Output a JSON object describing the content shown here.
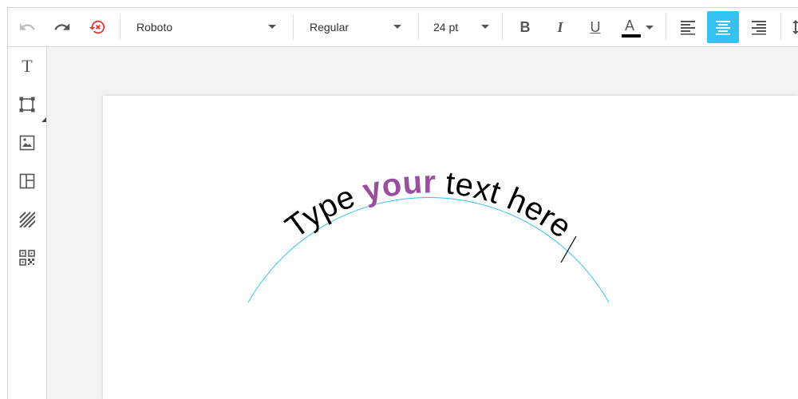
{
  "toolbar": {
    "font_family": "Roboto",
    "font_weight": "Regular",
    "font_size": "24 pt",
    "bold_label": "B",
    "italic_label": "I",
    "underline_label": "U",
    "font_color_label": "A",
    "font_color": "#000000",
    "accent_color": "#35c1f1",
    "active_alignment": "center"
  },
  "sidebar": {
    "items": [
      {
        "name": "text-tool",
        "icon": "text-icon"
      },
      {
        "name": "shape-tool",
        "icon": "shape-bounding-box-icon"
      },
      {
        "name": "image-tool",
        "icon": "image-icon"
      },
      {
        "name": "layout-tool",
        "icon": "layout-icon"
      },
      {
        "name": "pattern-tool",
        "icon": "diagonal-pattern-icon"
      },
      {
        "name": "qr-code-tool",
        "icon": "qr-code-icon"
      }
    ]
  },
  "canvas": {
    "text_parts": [
      {
        "text": "Type ",
        "bold": false,
        "color": "#000000"
      },
      {
        "text": "your",
        "bold": true,
        "color": "#9b4d9e"
      },
      {
        "text": " text here",
        "bold": false,
        "color": "#000000"
      }
    ],
    "curve_color": "#35c1f1"
  }
}
